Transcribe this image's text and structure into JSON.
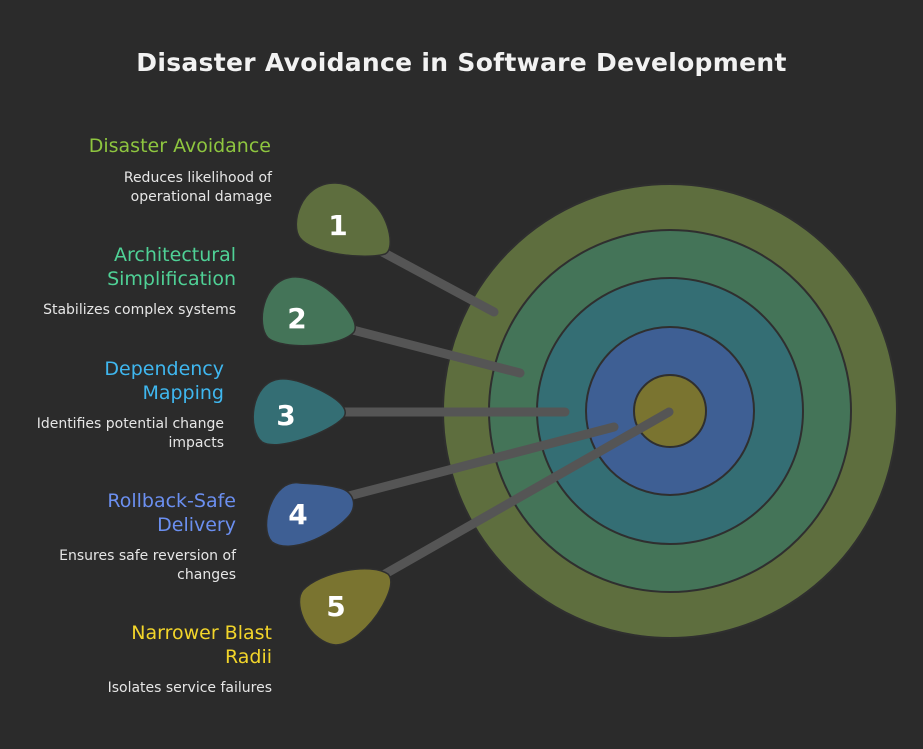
{
  "title": "Disaster Avoidance in Software Development",
  "colors": {
    "background": "#2b2b2b",
    "ring1": "#5e6e3e",
    "ring2": "#447458",
    "ring3": "#346e74",
    "ring4": "#3e5f94",
    "center": "#7a7430",
    "item1": "#8ec63f",
    "item2": "#4fd196",
    "item3": "#3fb7ef",
    "item4": "#6b8ff0",
    "item5": "#f2d52a"
  },
  "items": [
    {
      "number": "1",
      "title": "Disaster Avoidance",
      "description": "Reduces likelihood of operational damage"
    },
    {
      "number": "2",
      "title": "Architectural Simplification",
      "description": "Stabilizes complex systems"
    },
    {
      "number": "3",
      "title": "Dependency Mapping",
      "description": "Identifies potential change impacts"
    },
    {
      "number": "4",
      "title": "Rollback-Safe Delivery",
      "description": "Ensures safe reversion of changes"
    },
    {
      "number": "5",
      "title": "Narrower Blast Radii",
      "description": "Isolates service failures"
    }
  ]
}
